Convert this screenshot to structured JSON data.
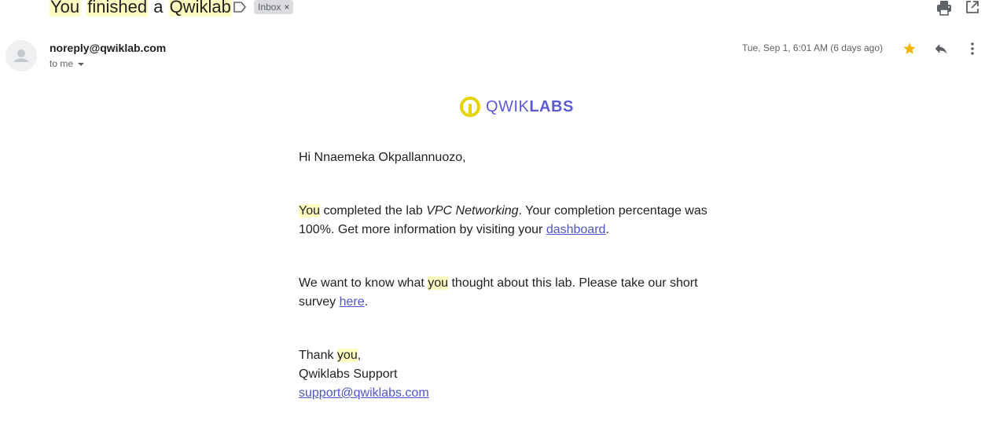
{
  "email": {
    "subject_parts": [
      {
        "text": "You",
        "highlight": true
      },
      {
        "text": " ",
        "highlight": false
      },
      {
        "text": "finished",
        "highlight": true
      },
      {
        "text": " a ",
        "highlight": false
      },
      {
        "text": "Qwiklab",
        "highlight": true
      }
    ],
    "label_chip": "Inbox",
    "chip_close": "×",
    "sender": "noreply@qwiklab.com",
    "recipient": "to me",
    "date": "Tue, Sep 1, 6:01 AM (6 days ago)",
    "starred": true
  },
  "logo": {
    "light": "QWIK",
    "bold": "LABS",
    "ring_color": "#e5d400",
    "text_color": "#5c5bd6"
  },
  "body": {
    "greeting": "Hi Nnaemeka Okpallannuozo,",
    "p1_you": "You",
    "p1_a": " completed the lab ",
    "p1_lab": "VPC Networking",
    "p1_b": ". Your completion percentage was 100%. Get more information by visiting your ",
    "p1_link": "dashboard",
    "p1_end": ".",
    "p2_a": "We want to know what ",
    "p2_you": "you",
    "p2_b": " thought about this lab. Please take our short survey ",
    "p2_link": "here",
    "p2_end": ".",
    "p3_thanks": "Thank ",
    "p3_you": "you",
    "p3_comma": ",",
    "p3_team": "Qwiklabs Support",
    "p3_email": "support@qwiklabs.com"
  },
  "icons": {
    "label": "label-icon",
    "print": "print-icon",
    "open": "open-in-new-icon",
    "avatar": "avatar-icon",
    "star": "star-icon",
    "reply": "reply-icon",
    "more": "more-vert-icon"
  },
  "colors": {
    "highlight": "#fdfbc0",
    "link": "#4d55c9",
    "star": "#f4b400"
  }
}
